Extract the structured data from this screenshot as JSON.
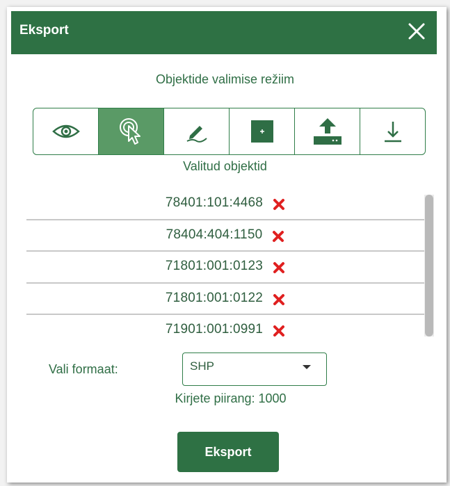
{
  "dialog": {
    "title": "Eksport",
    "close_icon": "close-icon"
  },
  "selection_mode": {
    "label": "Objektide valimise režiim",
    "tools": [
      {
        "icon": "eye-icon",
        "active": false
      },
      {
        "icon": "pointer-click-icon",
        "active": true
      },
      {
        "icon": "draw-icon",
        "active": false
      },
      {
        "icon": "add-square-icon",
        "active": false
      },
      {
        "icon": "upload-icon",
        "active": false
      },
      {
        "icon": "download-icon",
        "active": false
      }
    ]
  },
  "selected": {
    "label": "Valitud objektid",
    "items": [
      {
        "id": "78401:101:4468"
      },
      {
        "id": "78404:404:1150"
      },
      {
        "id": "71801:001:0123"
      },
      {
        "id": "71801:001:0122"
      },
      {
        "id": "71901:001:0991"
      }
    ],
    "remove_icon": "remove-x-icon"
  },
  "format": {
    "label": "Vali formaat:",
    "value": "SHP",
    "limit": "Kirjete piirang: 1000"
  },
  "actions": {
    "export_label": "Eksport"
  },
  "colors": {
    "header": "#2e7144",
    "accent": "#2f7d48",
    "active_tool": "#5a9a66",
    "remove": "#e02020"
  }
}
